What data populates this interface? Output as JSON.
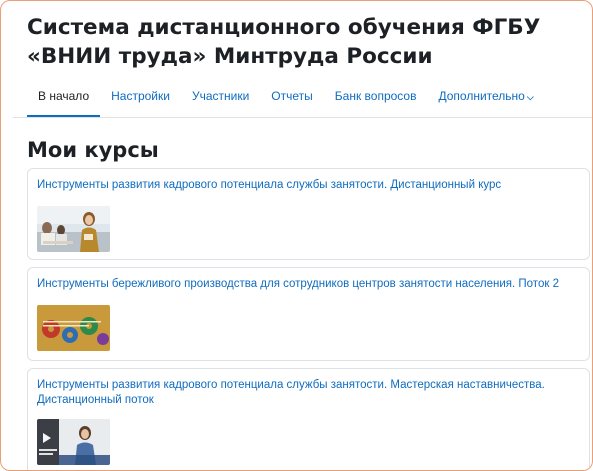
{
  "site": {
    "title": "Система дистанционного обучения ФГБУ «ВНИИ труда» Минтруда России"
  },
  "nav": {
    "items": [
      {
        "label": "В начало",
        "active": true
      },
      {
        "label": "Настройки",
        "active": false
      },
      {
        "label": "Участники",
        "active": false
      },
      {
        "label": "Отчеты",
        "active": false
      },
      {
        "label": "Банк вопросов",
        "active": false
      },
      {
        "label": "Дополнительно",
        "active": false,
        "icon": "chevron-down-icon"
      }
    ]
  },
  "main": {
    "heading": "Мои курсы",
    "courses": [
      {
        "title": "Инструменты развития кадрового потенциала службы занятости. Дистанционный курс",
        "image": "woman-in-classroom-thumbnail"
      },
      {
        "title": "Инструменты бережливого производства для сотрудников центров занятости населения. Поток 2",
        "image": "gears-thumbnail"
      },
      {
        "title": "Инструменты развития кадрового потенциала службы занятости. Мастерская наставничества. Дистанционный поток",
        "image": "video-presenter-thumbnail"
      }
    ]
  },
  "colors": {
    "link": "#0f6cbf",
    "text": "#1d2125",
    "border": "#dee2e6",
    "frame": "#e8a07a"
  }
}
